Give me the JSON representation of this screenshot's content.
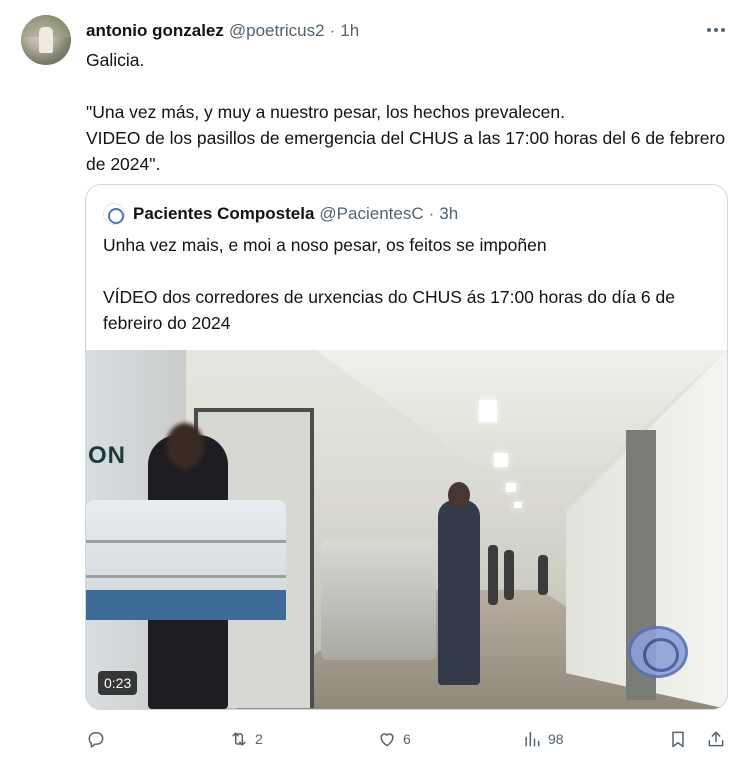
{
  "tweet": {
    "author_name": "antonio gonzalez",
    "author_handle": "@poetricus2",
    "separator": "·",
    "time": "1h",
    "text": "Galicia.\n\n\"Una vez más, y muy a nuestro pesar, los hechos prevalecen.\nVIDEO de los pasillos de emergencia del CHUS a las 17:00 horas del 6 de febrero de 2024\"."
  },
  "quote": {
    "author_name": "Pacientes Compostela",
    "author_handle": "@PacientesC",
    "separator": "·",
    "time": "3h",
    "text": "Unha vez mais, e moi a noso pesar, os feitos se impoñen\n\nVÍDEO dos corredores de urxencias do CHUS ás 17:00 horas do día 6 de febreiro do 2024",
    "video": {
      "duration": "0:23",
      "wall_sign": "ON"
    }
  },
  "actions": {
    "reply_count": "",
    "repost_count": "2",
    "like_count": "6",
    "views_count": "98"
  },
  "icons": {
    "more": "more-horizontal-icon",
    "reply": "reply-icon",
    "repost": "repost-icon",
    "like": "heart-icon",
    "views": "views-icon",
    "bookmark": "bookmark-icon",
    "share": "share-icon"
  },
  "colors": {
    "text": "#0f1419",
    "secondary": "#536471",
    "border": "#cfd9de"
  }
}
